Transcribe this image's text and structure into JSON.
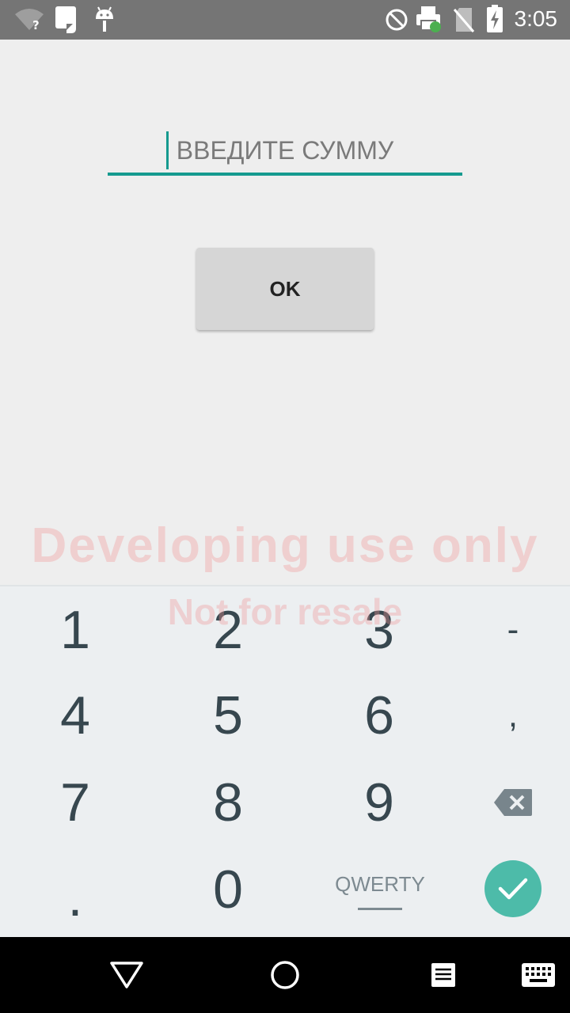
{
  "status_bar": {
    "time": "3:05",
    "icons": [
      "wifi-unknown-icon",
      "clipboard-icon",
      "android-debug-icon",
      "do-not-disturb-icon",
      "printer-icon",
      "no-sim-icon",
      "battery-charging-icon"
    ]
  },
  "form": {
    "amount_placeholder": "ВВЕДИТЕ СУММУ",
    "amount_value": "",
    "ok_label": "OK"
  },
  "watermark": {
    "line1": "Developing use only",
    "line2": "Not for resale"
  },
  "keyboard": {
    "keys": {
      "k1": "1",
      "k2": "2",
      "k3": "3",
      "minus": "-",
      "k4": "4",
      "k5": "5",
      "k6": "6",
      "comma": ",",
      "k7": "7",
      "k8": "8",
      "k9": "9",
      "dot": ".",
      "k0": "0",
      "qwerty": "QWERTY"
    },
    "backspace_icon": "backspace-icon",
    "done_icon": "checkmark-icon",
    "accent_color": "#4dbba9"
  },
  "nav_bar": {
    "icons": [
      "back-icon",
      "home-icon",
      "recents-icon",
      "keyboard-switch-icon"
    ]
  }
}
